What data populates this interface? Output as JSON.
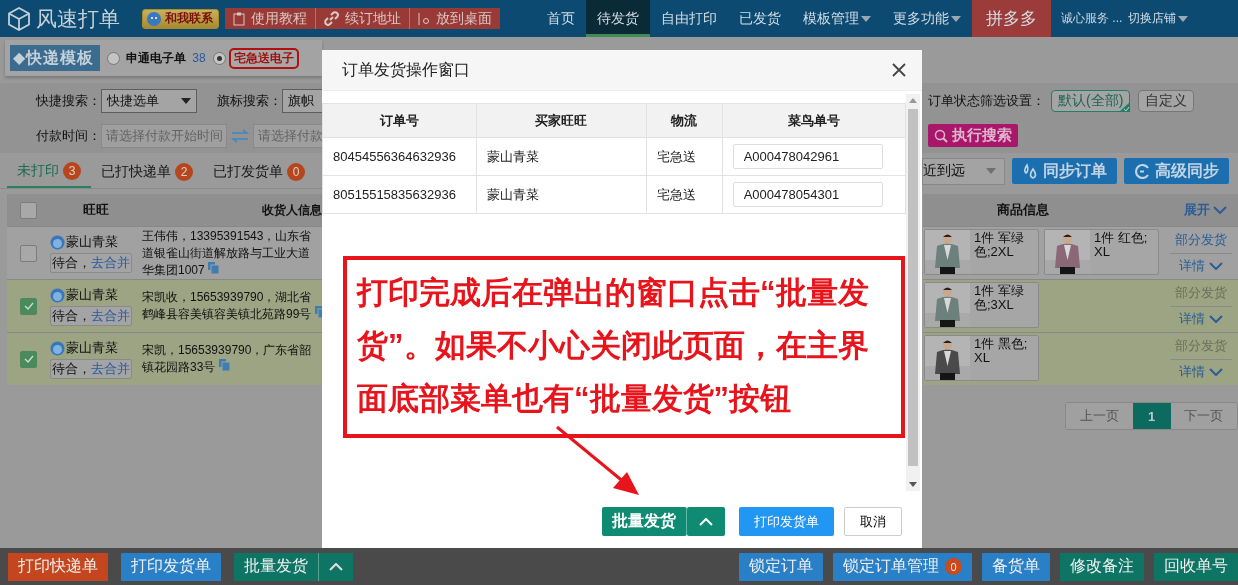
{
  "header": {
    "logo": "风速打单",
    "contact": "和我联系",
    "tools": [
      "使用教程",
      "续订地址",
      "放到桌面"
    ],
    "nav": [
      {
        "label": "首页",
        "selected": false,
        "dropdown": false,
        "kind": "link"
      },
      {
        "label": "待发货",
        "selected": true,
        "dropdown": false,
        "kind": "link"
      },
      {
        "label": "自由打印",
        "selected": false,
        "dropdown": false,
        "kind": "link"
      },
      {
        "label": "已发货",
        "selected": false,
        "dropdown": false,
        "kind": "link"
      },
      {
        "label": "模板管理",
        "selected": false,
        "dropdown": true,
        "kind": "link"
      },
      {
        "label": "更多功能",
        "selected": false,
        "dropdown": true,
        "kind": "link"
      },
      {
        "label": "拼多多",
        "selected": false,
        "dropdown": false,
        "kind": "platform"
      }
    ],
    "shop": {
      "name": "诚心服务 ...",
      "switch": "切换店铺"
    }
  },
  "templates": {
    "title": "◆快递模板",
    "options": [
      {
        "label": "申通电子单",
        "count": "38",
        "selected": false
      },
      {
        "label": "宅急送电子",
        "selected": true
      }
    ]
  },
  "search": {
    "fields": [
      {
        "label": "快捷搜索：",
        "value": "快捷选单",
        "arrow": true
      },
      {
        "label": "旗标搜索：",
        "value": "旗帜",
        "arrow": false
      }
    ],
    "pay_time": {
      "label": "付款时间：",
      "start_placeholder": "请选择付款开始时间",
      "end_placeholder": "请选择付款"
    },
    "status_filter": {
      "label": "订单状态筛选设置：",
      "options": [
        {
          "label": "默认(全部)",
          "selected": true
        },
        {
          "label": "自定义",
          "selected": false
        }
      ]
    },
    "search_button": "执行搜索"
  },
  "tabs": [
    {
      "label": "未打印",
      "count": "3",
      "selected": true
    },
    {
      "label": "已打快递单",
      "count": "2",
      "selected": false
    },
    {
      "label": "已打发货单",
      "count": "0",
      "selected": false
    }
  ],
  "sort": {
    "value": "近到远"
  },
  "sync_buttons": [
    "同步订单",
    "高级同步"
  ],
  "orders": {
    "select_all_checked": false,
    "columns": [
      "旺旺",
      "收货人信息",
      "商品信息"
    ],
    "expand": "展开",
    "rows": [
      {
        "checked": false,
        "buyer": "蒙山青菜",
        "merge_status": "待合，",
        "merge_link": "去合并",
        "address_lines": [
          "王伟伟，13395391543，山东省",
          "道银雀山街道解放路与工业大道",
          "华集团1007"
        ],
        "products": [
          "1件  军绿色;2XL",
          "1件  红色;XL"
        ],
        "partial_ship": "部分发货",
        "partial_disabled": false,
        "details": "详情"
      },
      {
        "checked": true,
        "buyer": "蒙山青菜",
        "merge_status": "待合，",
        "merge_link": "去合并",
        "address_lines": [
          "宋凯收，15653939790，湖北省",
          "鹤峰县容美镇容美镇北苑路99号"
        ],
        "products": [
          "1件  军绿色;3XL"
        ],
        "partial_ship": "部分发货",
        "partial_disabled": true,
        "details": "详情"
      },
      {
        "checked": true,
        "buyer": "蒙山青菜",
        "merge_status": "待合，",
        "merge_link": "去合并",
        "address_lines": [
          "宋凯，15653939790，广东省韶",
          "镇花园路33号"
        ],
        "products": [
          "1件  黑色;XL"
        ],
        "partial_ship": "部分发货",
        "partial_disabled": true,
        "details": "详情"
      }
    ]
  },
  "pagination": {
    "prev": "上一页",
    "pages": [
      {
        "label": "1",
        "selected": true
      }
    ],
    "next": "下一页"
  },
  "modal": {
    "title": "订单发货操作窗口",
    "columns": [
      "订单号",
      "买家旺旺",
      "物流",
      "菜鸟单号"
    ],
    "rows": [
      {
        "order_no": "80454556364632936",
        "buyer": "蒙山青菜",
        "logistics": "宅急送",
        "tracking": "A000478042961"
      },
      {
        "order_no": "80515515835632936",
        "buyer": "蒙山青菜",
        "logistics": "宅急送",
        "tracking": "A000478054301"
      }
    ],
    "note": "打印完成后在弹出的窗口点击“批量发货”。如果不小心关闭此页面，在主界面底部菜单也有“批量发货”按钮",
    "buttons": [
      {
        "label": "批量发货",
        "kind": "split"
      },
      {
        "label": "打印发货单",
        "kind": "primary"
      },
      {
        "label": "取消",
        "kind": "default"
      }
    ]
  },
  "bottom_bar": {
    "left": [
      {
        "label": "打印快递单",
        "color": "#c4461f",
        "split": false
      },
      {
        "label": "打印发货单",
        "color": "#2a80c6",
        "split": false
      },
      {
        "label": "批量发货",
        "color": "#0e7565",
        "split": true
      }
    ],
    "right": [
      {
        "label": "锁定订单",
        "color": "#2a80c6",
        "split": false
      },
      {
        "label": "锁定订单管理",
        "count": "0",
        "color": "#2a80c6",
        "split": false
      },
      {
        "label": "备货单",
        "color": "#2a80c6",
        "split": false
      },
      {
        "label": "修改备注",
        "color": "#0e7565",
        "split": false
      },
      {
        "label": "回收单号",
        "color": "#0e7565",
        "split": false
      }
    ]
  }
}
